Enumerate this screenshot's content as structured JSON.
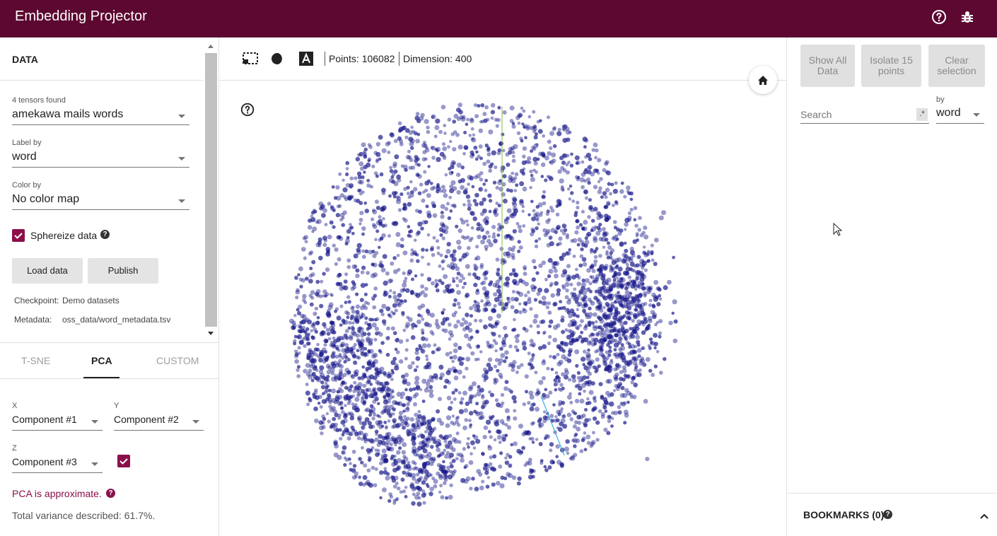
{
  "app": {
    "title": "Embedding Projector",
    "colors": {
      "brand": "#5c0830",
      "accent": "#8a0f4a",
      "points": "#1a1a8c"
    },
    "icons": {
      "help": "help-circle-icon",
      "bug": "bug-icon"
    }
  },
  "data_panel": {
    "title": "DATA",
    "tensors_label": "4 tensors found",
    "tensor_value": "amekawa mails words",
    "label_by_label": "Label by",
    "label_by_value": "word",
    "color_by_label": "Color by",
    "color_by_value": "No color map",
    "sphereize_label": "Sphereize data",
    "sphereize_checked": true,
    "load_button": "Load data",
    "publish_button": "Publish",
    "checkpoint_label": "Checkpoint:",
    "checkpoint_value": "Demo datasets",
    "metadata_label": "Metadata:",
    "metadata_value": "oss_data/word_metadata.tsv"
  },
  "projection_tabs": [
    {
      "label": "T-SNE",
      "active": false
    },
    {
      "label": "PCA",
      "active": true
    },
    {
      "label": "CUSTOM",
      "active": false
    }
  ],
  "pca": {
    "x_label": "X",
    "x_value": "Component #1",
    "y_label": "Y",
    "y_value": "Component #2",
    "z_label": "Z",
    "z_value": "Component #3",
    "z_enabled": true,
    "approx_text": "PCA is approximate.",
    "variance_text": "Total variance described: 61.7%."
  },
  "toolbar": {
    "points_text": "Points: 106082",
    "dimension_text": "Dimension: 400",
    "icons": [
      "selection-rect-icon",
      "night-mode-icon",
      "label-toggle-icon",
      "home-icon",
      "help-circle-icon"
    ]
  },
  "inspector": {
    "show_all_line1": "Show All",
    "show_all_line2": "Data",
    "isolate_line1": "Isolate 15",
    "isolate_line2": "points",
    "clear_line1": "Clear",
    "clear_line2": "selection",
    "search_placeholder": "Search",
    "regex_label": ".*",
    "by_label": "by",
    "by_value": "word",
    "bookmarks_label": "BOOKMARKS (0)"
  }
}
